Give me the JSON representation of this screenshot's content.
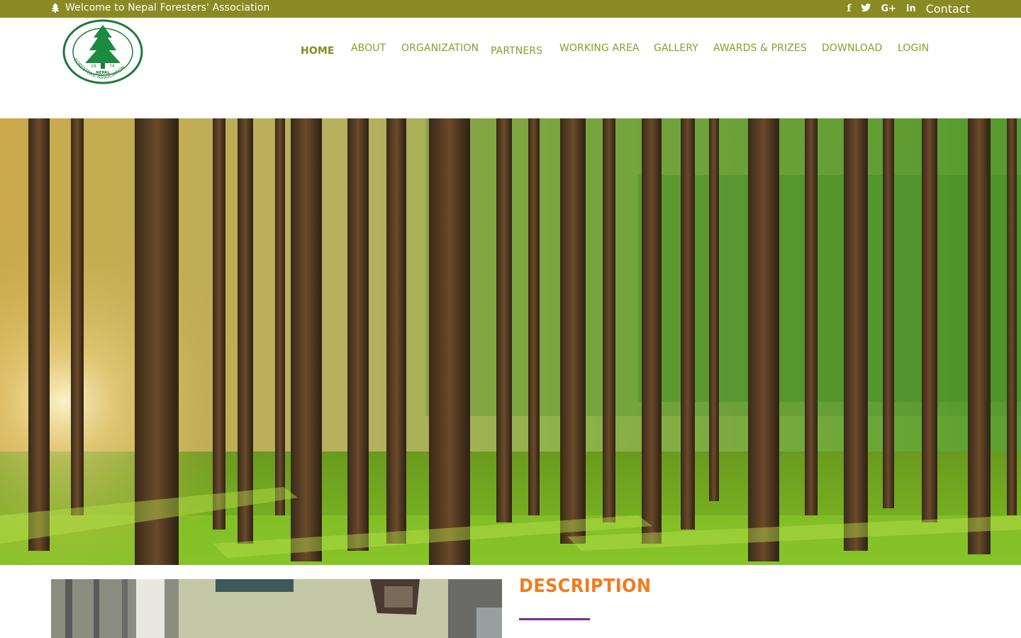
{
  "topbar": {
    "welcome_text": "Welcome to Nepal Foresters' Association",
    "social": {
      "facebook": "f",
      "twitter": "🐦",
      "googleplus": "G+",
      "linkedin": "in"
    },
    "contact_label": "Contact"
  },
  "logo": {
    "year_left": "19",
    "year_right": "74",
    "ring_text_top": "NEPAL",
    "ring_text_bottom": "FORESTERS' ASSOCIATION"
  },
  "nav": {
    "items": [
      {
        "label": "HOME"
      },
      {
        "label": "ABOUT"
      },
      {
        "label": "ORGANIZATION"
      },
      {
        "label": "PARTNERS"
      },
      {
        "label": "WORKING AREA"
      },
      {
        "label": "GALLERY"
      },
      {
        "label": "AWARDS & PRIZES"
      },
      {
        "label": "DOWNLOAD"
      },
      {
        "label": "LOGIN"
      }
    ]
  },
  "content": {
    "description_title": "DESCRIPTION"
  },
  "colors": {
    "topbar": "#8a8a24",
    "nav_text": "#8f9a2c",
    "title": "#f07c1e",
    "accent_line": "#7b2e92"
  }
}
